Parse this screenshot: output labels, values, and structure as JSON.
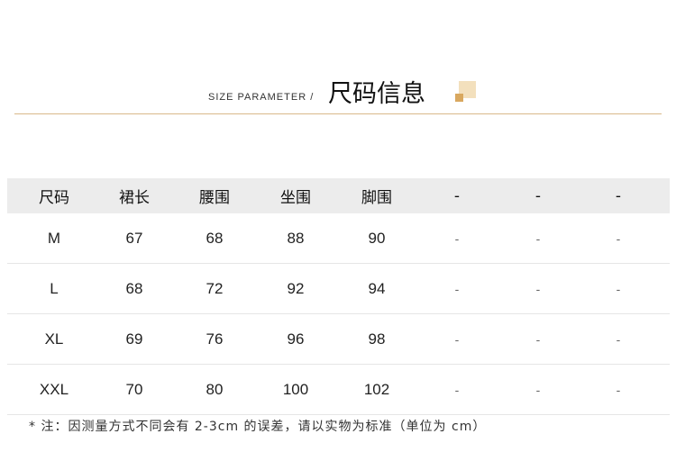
{
  "header": {
    "subtitle_en": "SIZE PARAMETER /",
    "title_cn": "尺码信息",
    "accent_light": "#f3e0bd",
    "accent_dark": "#d9a85f",
    "rule_color": "#d9b98a"
  },
  "table": {
    "columns": [
      "尺码",
      "裙长",
      "腰围",
      "坐围",
      "脚围",
      "-",
      "-",
      "-"
    ],
    "rows": [
      [
        "M",
        "67",
        "68",
        "88",
        "90",
        "-",
        "-",
        "-"
      ],
      [
        "L",
        "68",
        "72",
        "92",
        "94",
        "-",
        "-",
        "-"
      ],
      [
        "XL",
        "69",
        "76",
        "96",
        "98",
        "-",
        "-",
        "-"
      ],
      [
        "XXL",
        "70",
        "80",
        "100",
        "102",
        "-",
        "-",
        "-"
      ]
    ]
  },
  "footnote": "* 注：因测量方式不同会有 2-3cm 的误差，请以实物为标准（单位为 cm）"
}
